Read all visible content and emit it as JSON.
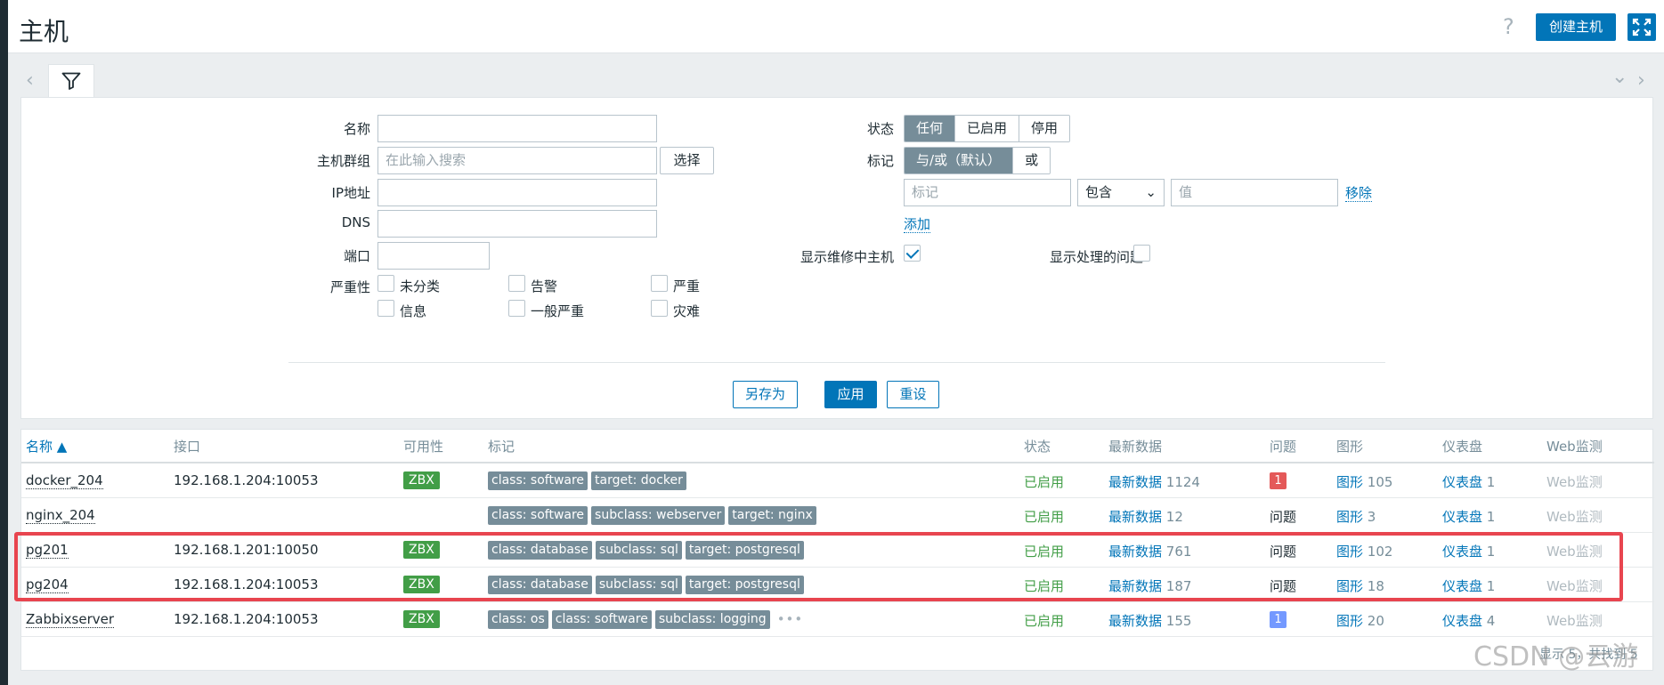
{
  "header": {
    "title": "主机",
    "help": "?",
    "create_button": "创建主机"
  },
  "filter": {
    "labels": {
      "name": "名称",
      "host_group": "主机群组",
      "ip": "IP地址",
      "dns": "DNS",
      "port": "端口",
      "severity": "严重性",
      "status": "状态",
      "tags": "标记",
      "show_maintenance": "显示维修中主机",
      "show_suppressed": "显示处理的问题"
    },
    "host_group_placeholder": "在此输入搜索",
    "select_button": "选择",
    "severities": [
      "未分类",
      "告警",
      "严重",
      "信息",
      "一般严重",
      "灾难"
    ],
    "status_options": [
      "任何",
      "已启用",
      "停用"
    ],
    "status_selected": "任何",
    "tag_eval_options": [
      "与/或（默认）",
      "或"
    ],
    "tag_eval_selected": "与/或（默认）",
    "tag_placeholder": "标记",
    "tag_operator": "包含",
    "tag_value_placeholder": "值",
    "remove_link": "移除",
    "add_link": "添加",
    "show_maintenance_checked": true,
    "show_suppressed_checked": false,
    "buttons": {
      "save_as": "另存为",
      "apply": "应用",
      "reset": "重设"
    }
  },
  "table": {
    "columns": [
      "名称 ▲",
      "接口",
      "可用性",
      "标记",
      "状态",
      "最新数据",
      "问题",
      "图形",
      "仪表盘",
      "Web监测"
    ],
    "rows": [
      {
        "name": "docker_204",
        "interface": "192.168.1.204:10053",
        "availability": "ZBX",
        "tags": [
          "class: software",
          "target: docker"
        ],
        "more_tags": "",
        "status": "已启用",
        "latest_label": "最新数据",
        "latest_count": "1124",
        "problems": "1",
        "problem_color": "#e45959",
        "graphs_label": "图形",
        "graphs_count": "105",
        "dash_label": "仪表盘",
        "dash_count": "1",
        "web": "Web监测"
      },
      {
        "name": "nginx_204",
        "interface": "",
        "availability": "",
        "tags": [
          "class: software",
          "subclass: webserver",
          "target: nginx"
        ],
        "more_tags": "",
        "status": "已启用",
        "latest_label": "最新数据",
        "latest_count": "12",
        "problems": "问题",
        "problem_color": "",
        "graphs_label": "图形",
        "graphs_count": "3",
        "dash_label": "仪表盘",
        "dash_count": "1",
        "web": "Web监测"
      },
      {
        "name": "pg201",
        "interface": "192.168.1.201:10050",
        "availability": "ZBX",
        "tags": [
          "class: database",
          "subclass: sql",
          "target: postgresql"
        ],
        "more_tags": "",
        "status": "已启用",
        "latest_label": "最新数据",
        "latest_count": "761",
        "problems": "问题",
        "problem_color": "",
        "graphs_label": "图形",
        "graphs_count": "102",
        "dash_label": "仪表盘",
        "dash_count": "1",
        "web": "Web监测"
      },
      {
        "name": "pg204",
        "interface": "192.168.1.204:10053",
        "availability": "ZBX",
        "tags": [
          "class: database",
          "subclass: sql",
          "target: postgresql"
        ],
        "more_tags": "",
        "status": "已启用",
        "latest_label": "最新数据",
        "latest_count": "187",
        "problems": "问题",
        "problem_color": "",
        "graphs_label": "图形",
        "graphs_count": "18",
        "dash_label": "仪表盘",
        "dash_count": "1",
        "web": "Web监测"
      },
      {
        "name": "Zabbixserver",
        "interface": "192.168.1.204:10053",
        "availability": "ZBX",
        "tags": [
          "class: os",
          "class: software",
          "subclass: logging"
        ],
        "more_tags": "•••",
        "status": "已启用",
        "latest_label": "最新数据",
        "latest_count": "155",
        "problems": "1",
        "problem_color": "#7499ff",
        "graphs_label": "图形",
        "graphs_count": "20",
        "dash_label": "仪表盘",
        "dash_count": "4",
        "web": "Web监测"
      }
    ],
    "footer": "显示 5，共找到 5"
  },
  "watermark": "CSDN @云游",
  "colors": {
    "accent": "#0275b8",
    "zbx_green": "#429e47",
    "tag_gray": "#768d99",
    "highlight_red": "#e8454f"
  }
}
